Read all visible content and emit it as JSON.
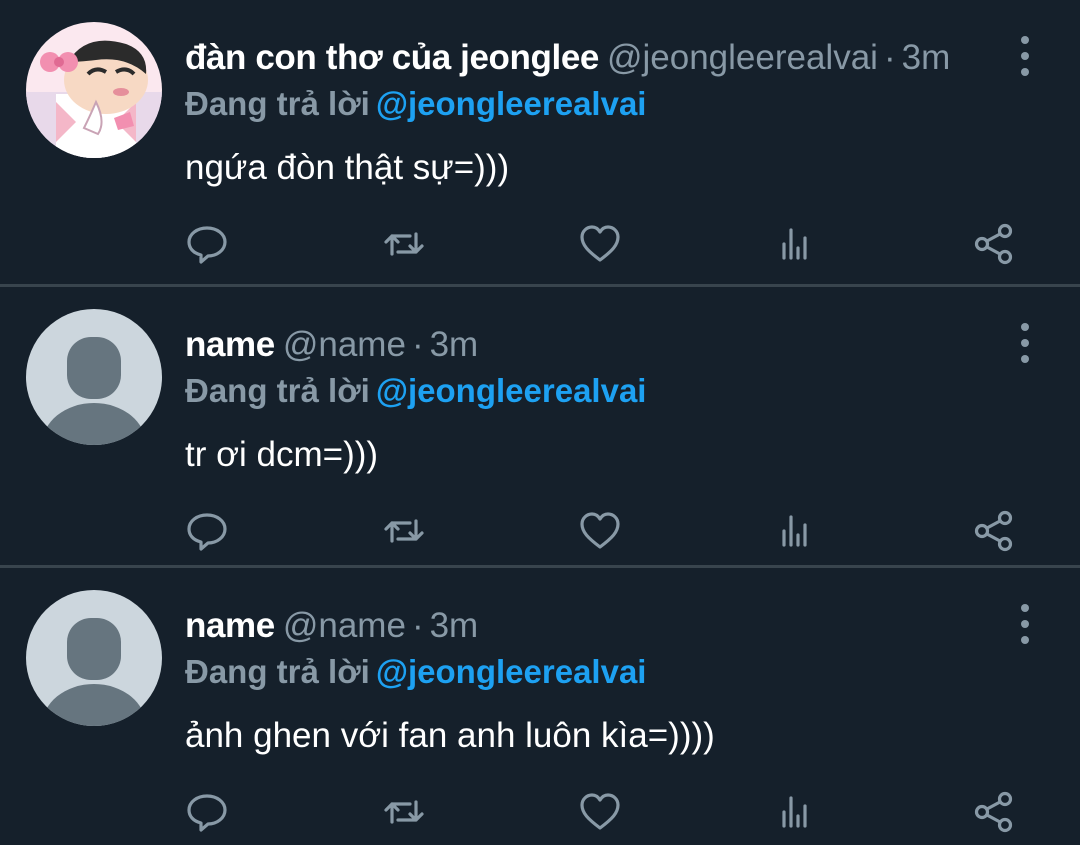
{
  "tweets": [
    {
      "display_name": "đàn con thơ của jeonglee",
      "handle": "@jeongleerealvai",
      "separator": "·",
      "time": "3m",
      "reply_prefix": "Đang trả lời",
      "reply_to": "@jeongleerealvai",
      "text": "ngứa đòn thật sự=)))",
      "avatar": "cartoon-avatar"
    },
    {
      "display_name": "name",
      "handle": "@name",
      "separator": "·",
      "time": "3m",
      "reply_prefix": "Đang trả lời",
      "reply_to": "@jeongleerealvai",
      "text": "tr ơi dcm=)))",
      "avatar": "default-avatar"
    },
    {
      "display_name": "name",
      "handle": "@name",
      "separator": "·",
      "time": "3m",
      "reply_prefix": "Đang trả lời",
      "reply_to": "@jeongleerealvai",
      "text": "ảnh ghen với fan anh luôn kìa=))))",
      "avatar": "default-avatar"
    }
  ],
  "actions": [
    "reply-icon",
    "retweet-icon",
    "like-icon",
    "analytics-icon",
    "share-icon"
  ],
  "colors": {
    "background": "#15202b",
    "divider": "#38444d",
    "text_primary": "#ffffff",
    "text_secondary": "#8899a6",
    "link": "#1da1f2"
  }
}
